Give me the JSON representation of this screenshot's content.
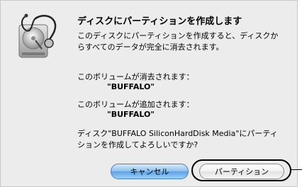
{
  "dialog": {
    "title": "ディスクにパーティションを作成します",
    "message_line1": "このディスクにパーティションを作成すると、ディスクか",
    "message_line2": "らすべてのデータが完全に消去されます。",
    "erased_label": "このボリュームが消去されます：",
    "erased_volume": "\"BUFFALO\"",
    "added_label": "このボリュームが追加されます：",
    "added_volume": "\"BUFFALO\"",
    "confirm_line1": "ディスク\"BUFFALO SiliconHardDisk Media\"にパーティ",
    "confirm_line2": "ションを作成してよろしいですか?"
  },
  "buttons": {
    "cancel_label": "キャンセル",
    "partition_label": "パーティション"
  },
  "icon": {
    "name": "disk-utility-icon"
  },
  "colors": {
    "sheet_bg": "#ececec",
    "default_button": "#5aa3e6",
    "callout": "#000000"
  }
}
